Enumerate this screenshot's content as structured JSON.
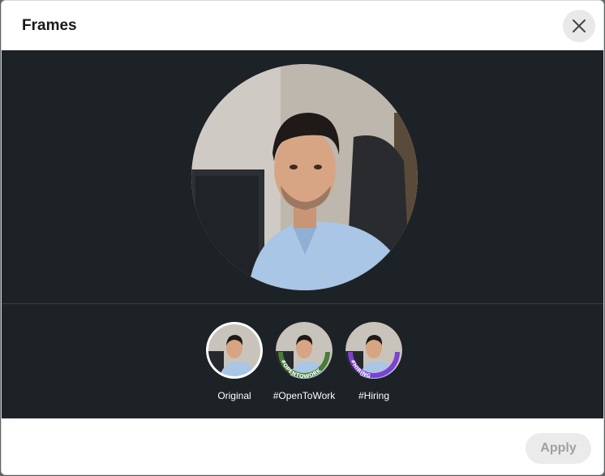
{
  "dialog": {
    "title": "Frames",
    "close_icon": "close-icon"
  },
  "frames": {
    "selected": "Original",
    "options": [
      {
        "label": "Original",
        "banner": ""
      },
      {
        "label": "#OpenToWork",
        "banner": "#OPENTOWORK",
        "color": "#487d37"
      },
      {
        "label": "#Hiring",
        "banner": "#HIRING",
        "color": "#7e41d1"
      }
    ]
  },
  "footer": {
    "apply_label": "Apply"
  },
  "colors": {
    "dark_bg": "#1d2226",
    "open_to_work": "#487d37",
    "hiring": "#7e41d1",
    "apply_disabled_bg": "#ebebeb"
  }
}
